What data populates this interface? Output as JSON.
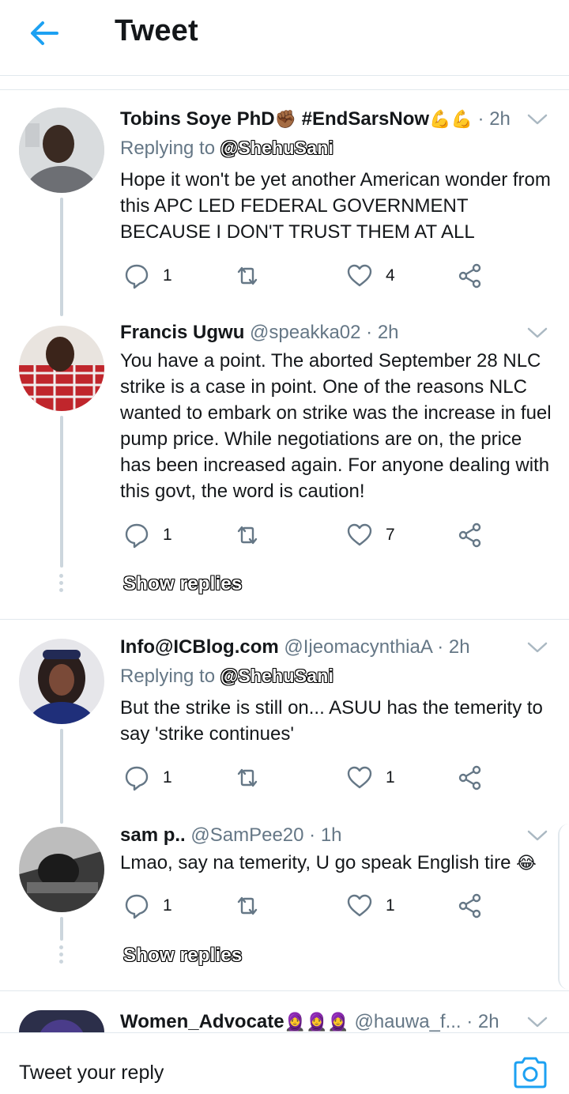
{
  "header": {
    "title": "Tweet"
  },
  "tweets": [
    {
      "name": "Tobins Soye PhD",
      "name_emoji": "✊🏾",
      "hashtag": "#EndSarsNow",
      "hashtag_emoji": "💪💪",
      "handle": "",
      "time": "2h",
      "reply_prefix": "Replying to",
      "reply_to": "@ShehuSani",
      "text": "Hope it won't be yet another American wonder from this APC LED FEDERAL GOVERNMENT BECAUSE I DON'T TRUST THEM AT ALL",
      "reply_count": "1",
      "like_count": "4"
    },
    {
      "name": "Francis Ugwu",
      "handle": "@speakka02",
      "time": "2h",
      "text": "You have a point. The aborted September 28 NLC strike is a case in point. One of the reasons NLC wanted to embark on strike was the increase in fuel pump price. While negotiations are on, the price has been increased again. For anyone dealing with this govt, the word is caution!",
      "reply_count": "1",
      "like_count": "7"
    },
    {
      "name": "Info@ICBlog.com",
      "handle": "@IjeomacynthiaA",
      "time": "2h",
      "reply_prefix": "Replying to",
      "reply_to": "@ShehuSani",
      "text": "But the strike is still on... ASUU has the temerity to say 'strike continues'",
      "reply_count": "1",
      "like_count": "1"
    },
    {
      "name": "sam p..",
      "handle": "@SamPee20",
      "time": "1h",
      "text": "Lmao, say na temerity, U go speak English tire",
      "text_emoji": "😂",
      "reply_count": "1",
      "like_count": "1"
    },
    {
      "name": "Women_Advocate",
      "name_emoji": "🧕🧕🧕",
      "handle": "@hauwa_f...",
      "time": "2h"
    }
  ],
  "show_replies_label": "Show replies",
  "separator": "·",
  "compose": {
    "placeholder": "Tweet your reply"
  },
  "icons": {
    "back": "arrow-left-icon",
    "chevron": "chevron-down-icon",
    "reply": "comment-bubble-icon",
    "retweet": "retweet-icon",
    "like": "heart-icon",
    "share": "share-icon",
    "camera": "camera-icon"
  },
  "colors": {
    "accent": "#1da1f2",
    "muted": "#657786",
    "divider": "#e1e8ed",
    "thread": "#ccd6dd"
  }
}
